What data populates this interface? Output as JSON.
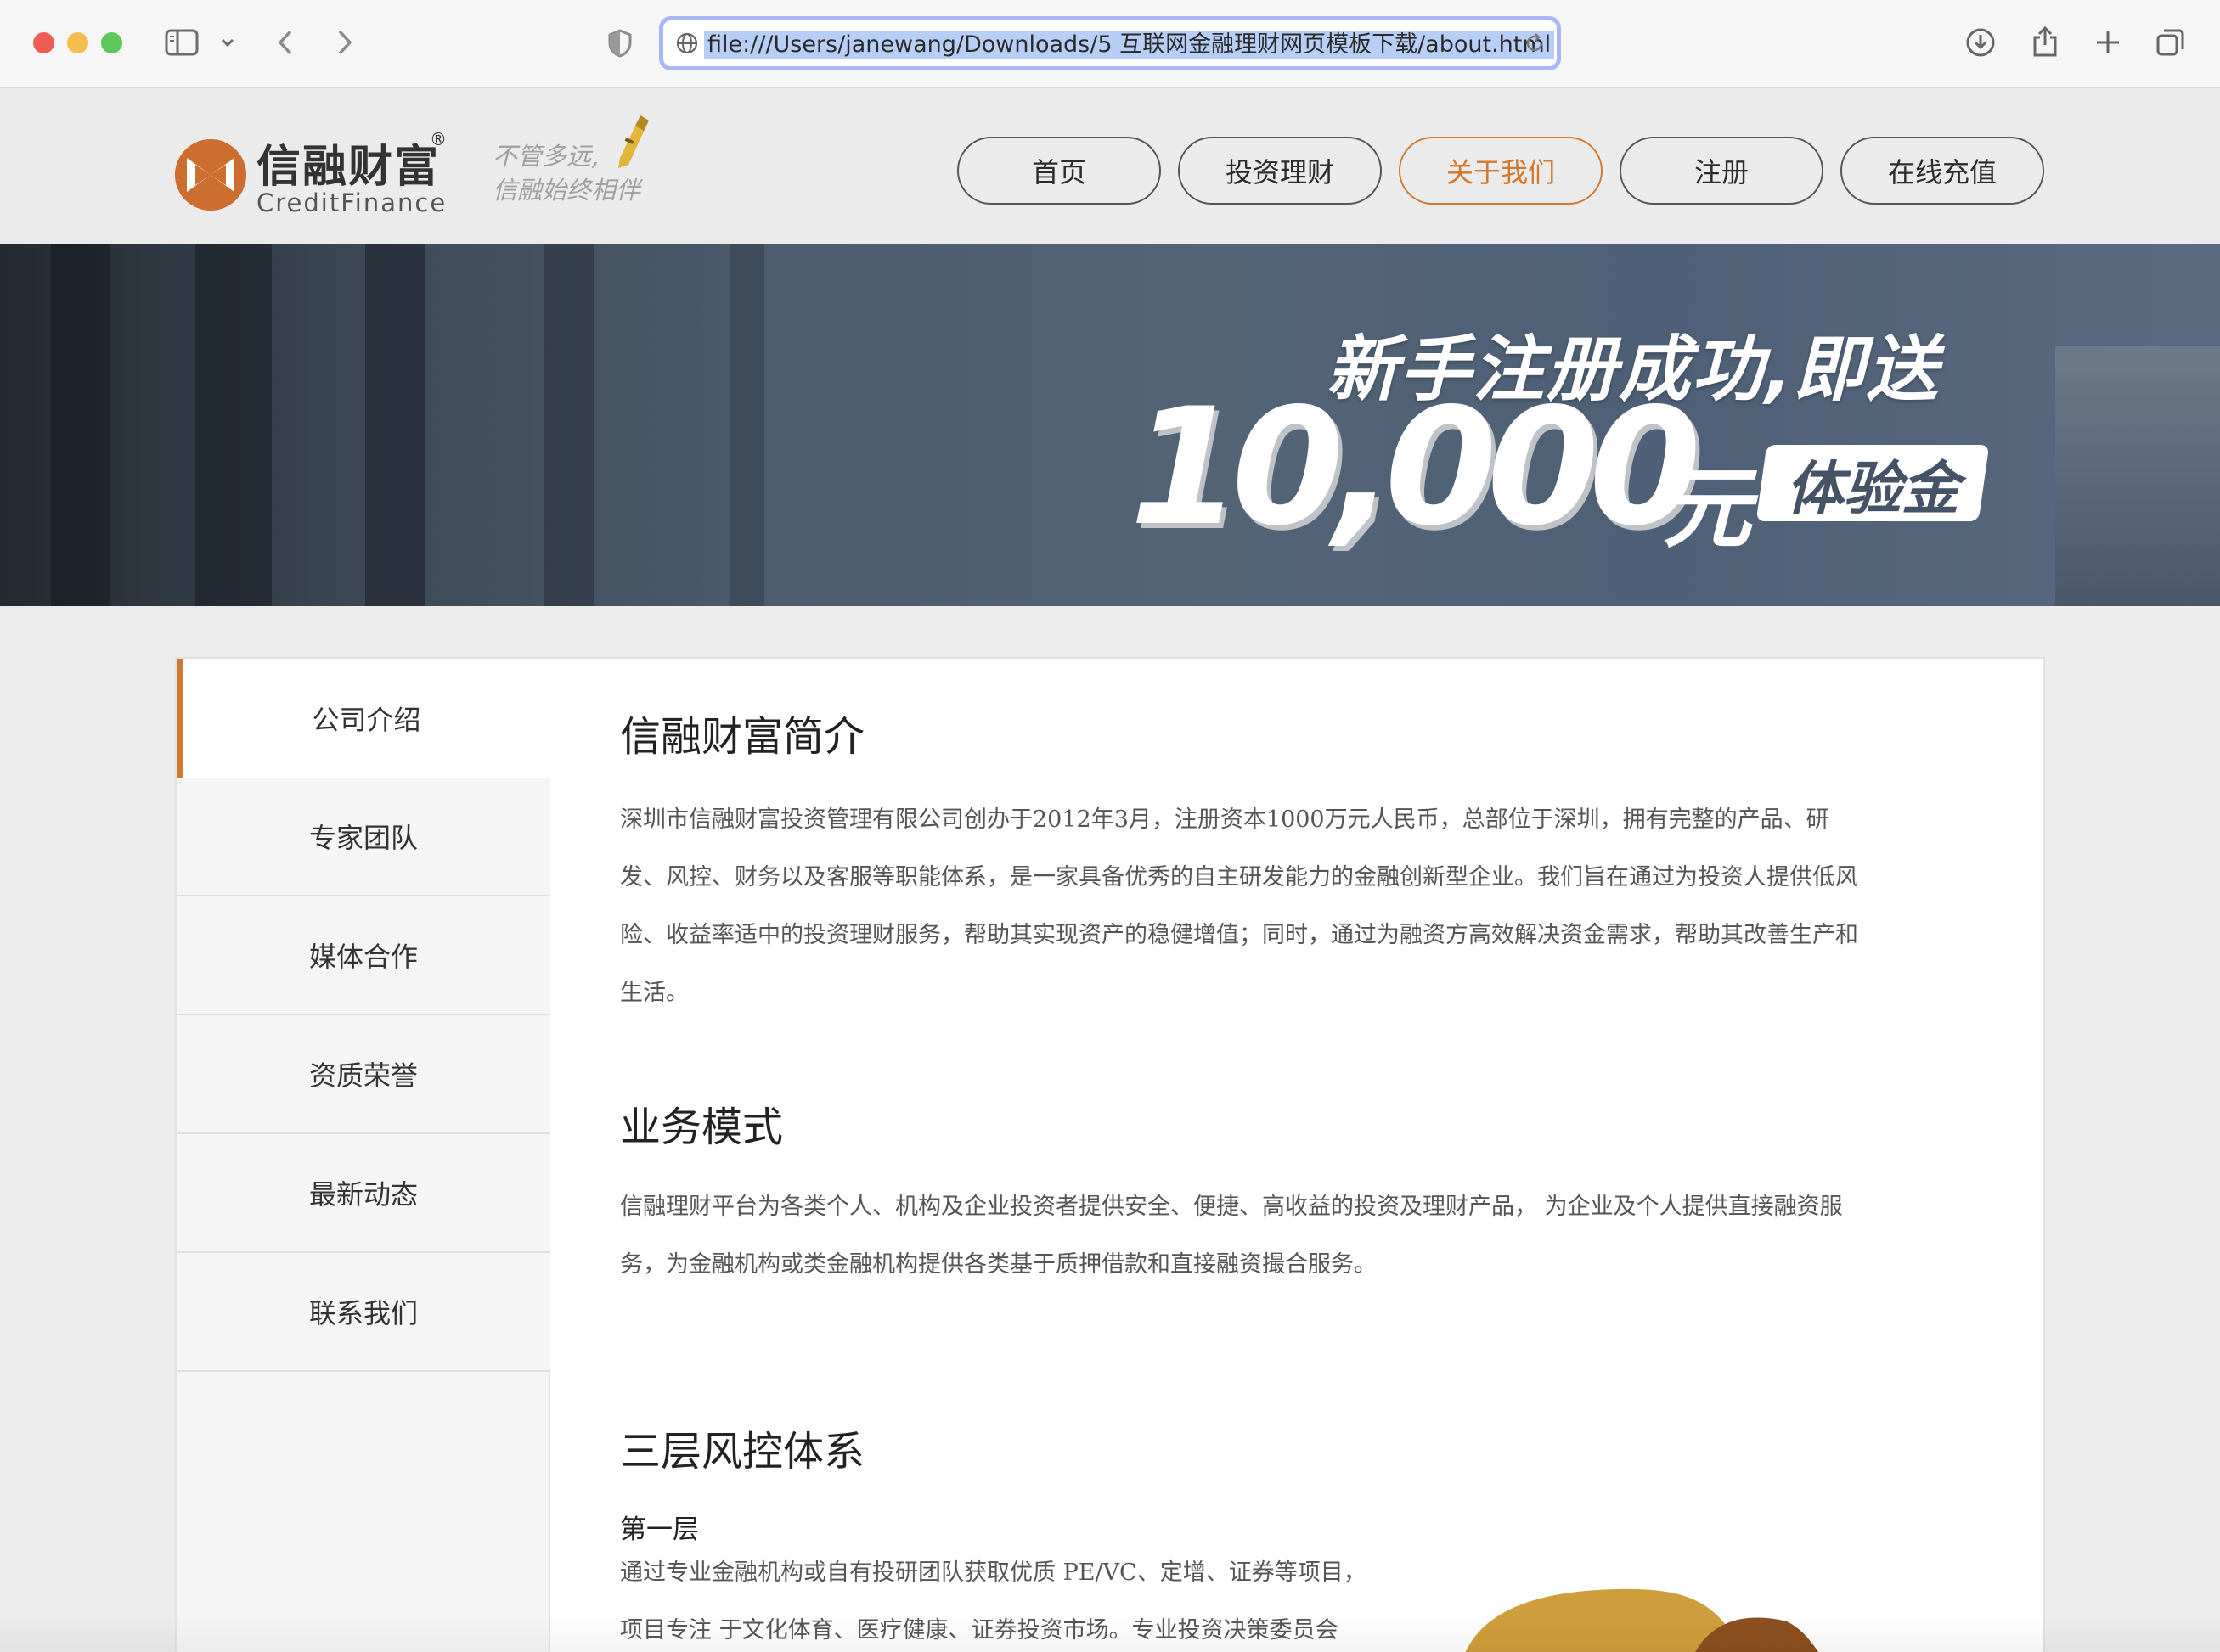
{
  "browser": {
    "url": "file:///Users/janewang/Downloads/5 互联网金融理财网页模板下载/about.html"
  },
  "header": {
    "logo_cn": "信融财富",
    "logo_reg": "®",
    "logo_en": "CreditFinance",
    "slogan_line1": "不管多远,",
    "slogan_line2": "信融始终相伴",
    "nav": [
      {
        "label": "首页",
        "active": false
      },
      {
        "label": "投资理财",
        "active": false
      },
      {
        "label": "关于我们",
        "active": true
      },
      {
        "label": "注册",
        "active": false
      },
      {
        "label": "在线充值",
        "active": false
      }
    ]
  },
  "banner": {
    "line1": "新手注册成功,即送",
    "amount": "10,000",
    "unit": "元",
    "tag": "体验金"
  },
  "sidebar": {
    "items": [
      {
        "label": "公司介绍",
        "active": true
      },
      {
        "label": "专家团队",
        "active": false
      },
      {
        "label": "媒体合作",
        "active": false
      },
      {
        "label": "资质荣誉",
        "active": false
      },
      {
        "label": "最新动态",
        "active": false
      },
      {
        "label": "联系我们",
        "active": false
      }
    ]
  },
  "main": {
    "section1": {
      "title": "信融财富简介",
      "body": "深圳市信融财富投资管理有限公司创办于2012年3月，注册资本1000万元人民币，总部位于深圳，拥有完整的产品、研发、风控、财务以及客服等职能体系，是一家具备优秀的自主研发能力的金融创新型企业。我们旨在通过为投资人提供低风险、收益率适中的投资理财服务，帮助其实现资产的稳健增值；同时，通过为融资方高效解决资金需求，帮助其改善生产和生活。"
    },
    "section2": {
      "title": "业务模式",
      "body": "信融理财平台为各类个人、机构及企业投资者提供安全、便捷、高收益的投资及理财产品， 为企业及个人提供直接融资服务，为金融机构或类金融机构提供各类基于质押借款和直接融资撮合服务。"
    },
    "section3": {
      "title": "三层风控体系",
      "subtitle": "第一层",
      "line1": "通过专业金融机构或自有投研团队获取优质 PE/VC、定增、证券等项目，",
      "line2": "项目专注 于文化体育、医疗健康、证券投资市场。专业投资决策委员会"
    }
  },
  "colors": {
    "accent": "#d2782f",
    "nav_border": "#555555",
    "sidebar_bg": "#f5f5f5"
  }
}
